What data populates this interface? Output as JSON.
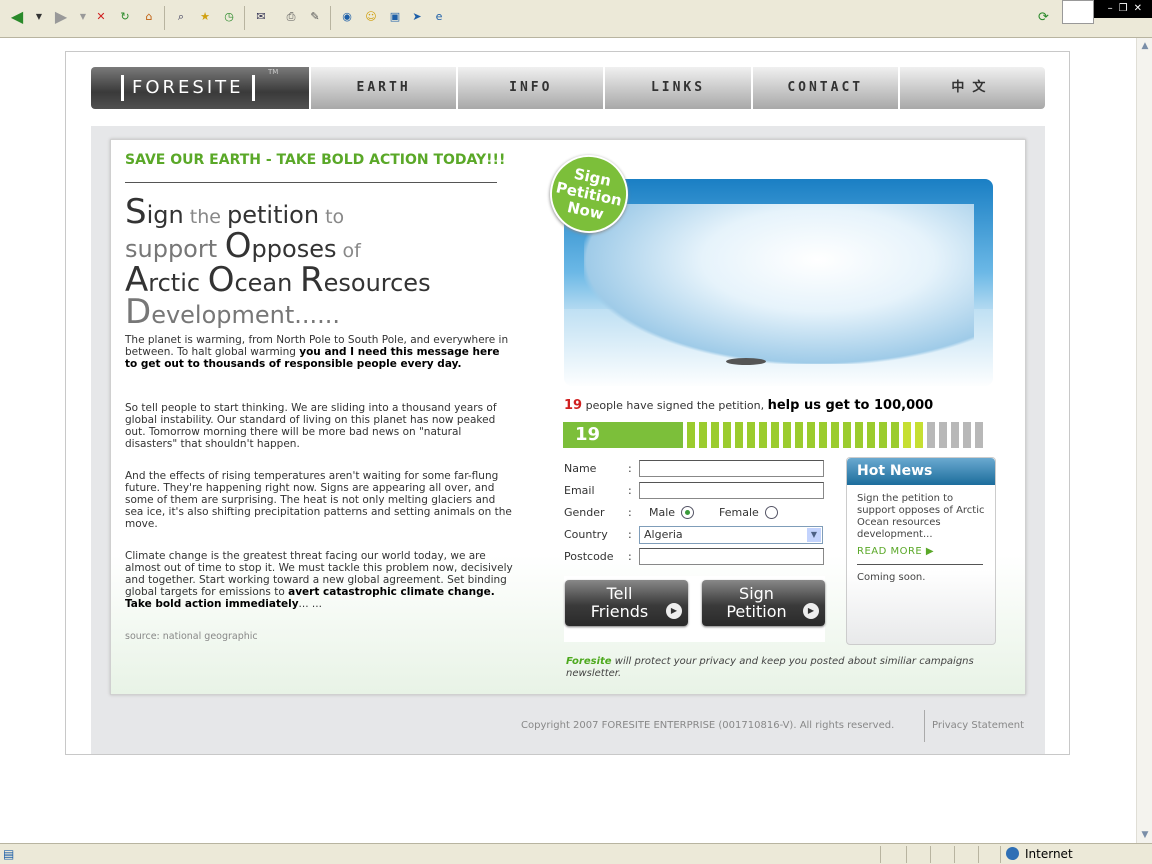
{
  "browser": {
    "status_zone": "Internet"
  },
  "nav": {
    "logo": "FORESITE",
    "logo_tm": "TM",
    "items": [
      "EARTH",
      "INFO",
      "LINKS",
      "CONTACT",
      "中文"
    ]
  },
  "main": {
    "headline": "SAVE OUR EARTH - TAKE BOLD ACTION TODAY!!!",
    "big_title": {
      "l1": [
        "S",
        "ign",
        " the ",
        "petition",
        " to"
      ],
      "l2": [
        "support ",
        "O",
        "pposes",
        " of"
      ],
      "l3": [
        "A",
        "rctic ",
        "O",
        "cean ",
        "R",
        "esources"
      ],
      "l4": [
        "D",
        "evelopment......"
      ]
    },
    "para1_a": "The planet is warming, from North Pole to South Pole, and everywhere in between. To halt global warming ",
    "para1_b": "you and I need this message here to get out to thousands of responsible people every day.",
    "para2": "So tell people to start thinking. We are sliding into a thousand years of global instability. Our standard of living on this planet has now peaked out. Tomorrow morning there will be more bad news on \"natural disasters\" that shouldn't happen.",
    "para3": "And the effects of rising temperatures aren't waiting for some far-flung future. They're happening right now. Signs are appearing all over, and some of them are surprising. The heat is not only melting glaciers and sea ice, it's also shifting precipitation patterns and setting animals on the move.",
    "para4_a": "Climate change is the greatest threat facing our world today, we are almost out of time to stop it. We must tackle this problem now, decisively and together. Start working toward a new global agreement. Set binding global targets for emissions to ",
    "para4_b": "avert catastrophic climate change. Take bold action immediately",
    "para4_c": "... ...",
    "source": "source: national geographic"
  },
  "petition": {
    "badge": "Sign Petition Now",
    "signed_count": "19",
    "signed_text": " people have signed the petition, ",
    "help_text": "help us get to 100,000",
    "progress_label": "19",
    "progress_fraction": 0.28,
    "colors": {
      "accent_green": "#7cbf3a",
      "light_green": "#9bcc2e",
      "yellow_green": "#c6df32",
      "grey": "#b8b8b8"
    }
  },
  "form": {
    "name_label": "Name",
    "email_label": "Email",
    "gender_label": "Gender",
    "male_label": "Male",
    "female_label": "Female",
    "country_label": "Country",
    "country_value": "Algeria",
    "postcode_label": "Postcode",
    "colon": ":",
    "tell_friends": [
      "Tell",
      "Friends"
    ],
    "sign_petition": [
      "Sign",
      "Petition"
    ],
    "privacy_brand": "Foresite",
    "privacy_text": " will protect your privacy and keep you posted about similiar campaigns newsletter."
  },
  "news": {
    "title": "Hot News",
    "text": "Sign the petition to support opposes of Arctic Ocean resources development...",
    "read_more": "READ MORE ▶",
    "soon": "Coming soon."
  },
  "footer": {
    "copyright": "Copyright 2007 FORESITE ENTERPRISE (001710816-V). All rights reserved.",
    "privacy": "Privacy Statement"
  }
}
